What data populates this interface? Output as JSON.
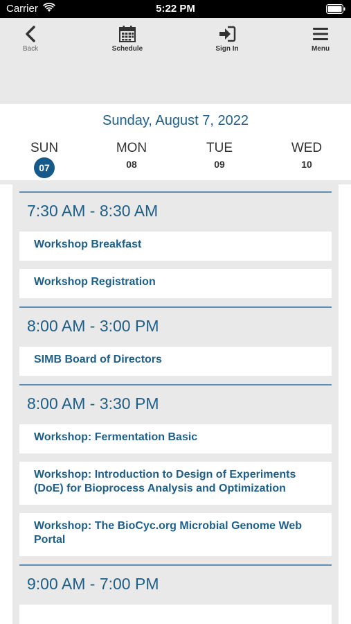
{
  "status_bar": {
    "carrier": "Carrier",
    "time": "5:22 PM"
  },
  "nav": {
    "back_label": "Back",
    "schedule_label": "Schedule",
    "signin_label": "Sign In",
    "menu_label": "Menu"
  },
  "date_title": "Sunday, August 7, 2022",
  "days": [
    {
      "name": "SUN",
      "num": "07",
      "selected": true
    },
    {
      "name": "MON",
      "num": "08",
      "selected": false
    },
    {
      "name": "TUE",
      "num": "09",
      "selected": false
    },
    {
      "name": "WED",
      "num": "10",
      "selected": false
    }
  ],
  "time_blocks": [
    {
      "time": "7:30 AM - 8:30 AM",
      "sessions": [
        "Workshop Breakfast",
        "Workshop Registration"
      ]
    },
    {
      "time": "8:00 AM - 3:00 PM",
      "sessions": [
        "SIMB Board of Directors"
      ]
    },
    {
      "time": "8:00 AM - 3:30 PM",
      "sessions": [
        "Workshop: Fermentation Basic",
        "Workshop: Introduction to Design of Experiments (DoE) for Bioprocess Analysis and Optimization",
        "Workshop: The BioCyc.org Microbial Genome Web Portal"
      ]
    },
    {
      "time": "9:00 AM - 7:00 PM",
      "sessions": [
        ""
      ]
    }
  ],
  "colors": {
    "accent": "#1f5f87",
    "selected_day": "#155a8a",
    "divider": "#5b8fb8",
    "background": "#e9e9e9"
  }
}
